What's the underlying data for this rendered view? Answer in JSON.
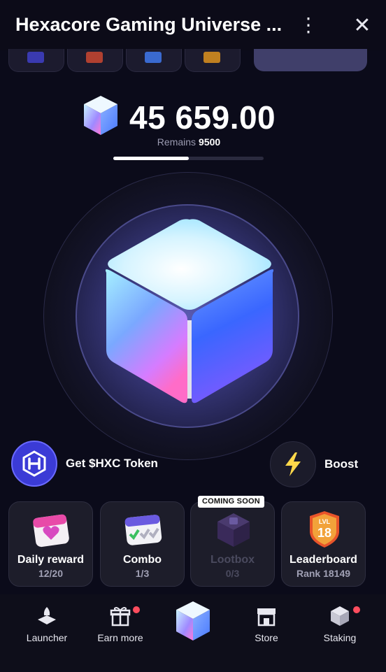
{
  "app": {
    "title": "Hexacore Gaming Universe ..."
  },
  "balance": {
    "value": "45 659.00",
    "remains_label": "Remains",
    "remains_value": "9500",
    "progress_fraction": 0.5
  },
  "actions": {
    "get_token": "Get $HXC Token",
    "boost": "Boost"
  },
  "cards": [
    {
      "title": "Daily reward",
      "sub": "12/20"
    },
    {
      "title": "Combo",
      "sub": "1/3"
    },
    {
      "title": "Lootbox",
      "sub": "0/3",
      "badge": "COMING SOON"
    },
    {
      "title": "Leaderboard",
      "sub": "Rank 18149",
      "badge_text": "LVL 18"
    }
  ],
  "nav": [
    {
      "label": "Launcher"
    },
    {
      "label": "Earn more"
    },
    {
      "label": "Store"
    },
    {
      "label": "Staking"
    }
  ],
  "colors": {
    "background": "#0b0b1a",
    "accent": "#3b3bd6",
    "notification": "#ff4d5e"
  }
}
